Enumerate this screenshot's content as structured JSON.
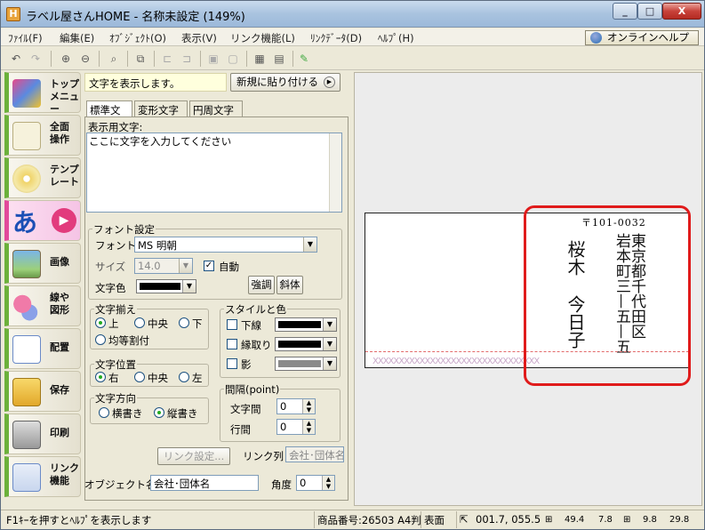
{
  "window": {
    "title": "ラベル屋さんHOME - 名称未設定 (149%)",
    "app_icon": "H",
    "min": "_",
    "max": "□",
    "close": "X"
  },
  "menu": {
    "items": [
      "ﾌｧｲﾙ(F)",
      "編集(E)",
      "ｵﾌﾞｼﾞｪｸﾄ(O)",
      "表示(V)",
      "リンク機能(L)",
      "ﾘﾝｸﾃﾞｰﾀ(D)",
      "ﾍﾙﾌﾟ(H)"
    ],
    "online_help": "オンラインヘルプ"
  },
  "toolbar": {
    "icons": [
      "undo-icon",
      "redo-icon",
      "zoom-in-icon",
      "zoom-out-icon",
      "zoom-fit-icon",
      "group-icon",
      "align-left-icon",
      "align-right-icon",
      "lock-icon",
      "unlock-icon",
      "grid-icon",
      "preview-icon",
      "paint-icon"
    ]
  },
  "sidebar": {
    "items": [
      {
        "label": "トップ\nメニュー",
        "icon": "home-icon"
      },
      {
        "label": "全面\n操作",
        "icon": "page-icon"
      },
      {
        "label": "テンプ\nレート",
        "icon": "cd-icon"
      },
      {
        "label": "",
        "icon": "text-icon",
        "glyph": "あ"
      },
      {
        "label": "画像",
        "icon": "image-icon"
      },
      {
        "label": "線や\n図形",
        "icon": "shapes-icon"
      },
      {
        "label": "配置",
        "icon": "layout-icon"
      },
      {
        "label": "保存",
        "icon": "folder-icon"
      },
      {
        "label": "印刷",
        "icon": "printer-icon"
      },
      {
        "label": "リンク\n機能",
        "icon": "link-icon"
      }
    ]
  },
  "panel": {
    "hint": "文字を表示します。",
    "paste_new": "新規に貼り付ける",
    "tabs": [
      "標準文字",
      "変形文字",
      "円周文字"
    ],
    "display_text_label": "表示用文字:",
    "display_text_value": "ここに文字を入力してください",
    "font_group": "フォント設定",
    "font_label": "フォント",
    "font_value": "MS 明朝",
    "size_label": "サイズ",
    "size_value": "14.0",
    "auto_label": "自動",
    "color_label": "文字色",
    "bold_label": "強調",
    "italic_label": "斜体",
    "align_group": "文字揃え",
    "align_top": "上",
    "align_middle": "中央",
    "align_bottom": "下",
    "align_even": "均等割付",
    "pos_group": "文字位置",
    "pos_right": "右",
    "pos_center": "中央",
    "pos_left": "左",
    "dir_group": "文字方向",
    "dir_horizontal": "横書き",
    "dir_vertical": "縦書き",
    "style_group": "スタイルと色",
    "underline": "下線",
    "outline": "縁取り",
    "shadow": "影",
    "spacing_group": "間隔(point)",
    "char_spacing": "文字間",
    "char_spacing_value": "0",
    "line_spacing": "行間",
    "line_spacing_value": "0",
    "link_settings": "リンク設定...",
    "link_col_label": "リンク列",
    "link_col_value": "会社･団体名",
    "object_name_label": "オブジェクト名",
    "object_name_value": "会社･団体名",
    "angle_label": "角度",
    "angle_value": "0"
  },
  "label_preview": {
    "zip": "〒101-0032",
    "address1": "東京都千代田区",
    "address2": "岩本町三—五—五",
    "name1": "桜木",
    "name2": "今日子",
    "hatch": "XXXXXXXXXXXXXXXXXXXXXXXXXXXXXXXX"
  },
  "status": {
    "help": "F1ｷｰを押すとﾍﾙﾌﾟを表示します",
    "product": "商品番号:26503 A4判",
    "side": "表面",
    "pos": "001.7, 055.5",
    "w": "49.4",
    "h": "7.8",
    "w2": "9.8",
    "h2": "29.8"
  },
  "colors": {
    "accent": "#e01b1b",
    "sidebar_green": "#6bb13b",
    "active_pink": "#e24a9a"
  }
}
